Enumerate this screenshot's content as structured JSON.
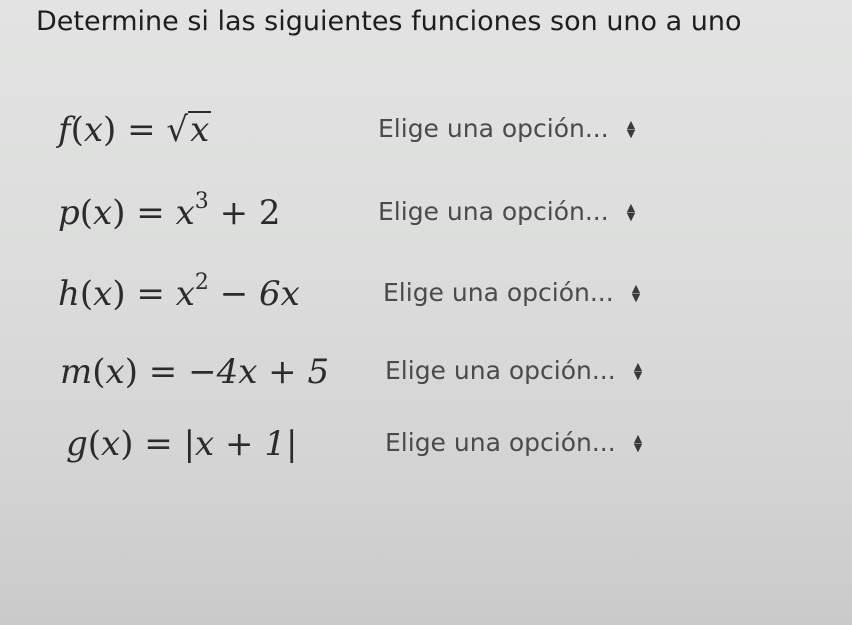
{
  "instruction": "Determine si las siguientes funciones son uno a uno",
  "select_placeholder": "Elige una opción...",
  "functions": [
    {
      "name": "f",
      "var": "x",
      "rhs": "x"
    },
    {
      "name": "p",
      "var": "x",
      "rhs_base": "x",
      "rhs_exp": "3",
      "rhs_rest": " + 2"
    },
    {
      "name": "h",
      "var": "x",
      "rhs_base": "x",
      "rhs_exp": "2",
      "rhs_rest": " − 6x"
    },
    {
      "name": "m",
      "var": "x",
      "rhs": "−4x + 5"
    },
    {
      "name": "g",
      "var": "x",
      "rhs": "|x + 1|"
    }
  ]
}
